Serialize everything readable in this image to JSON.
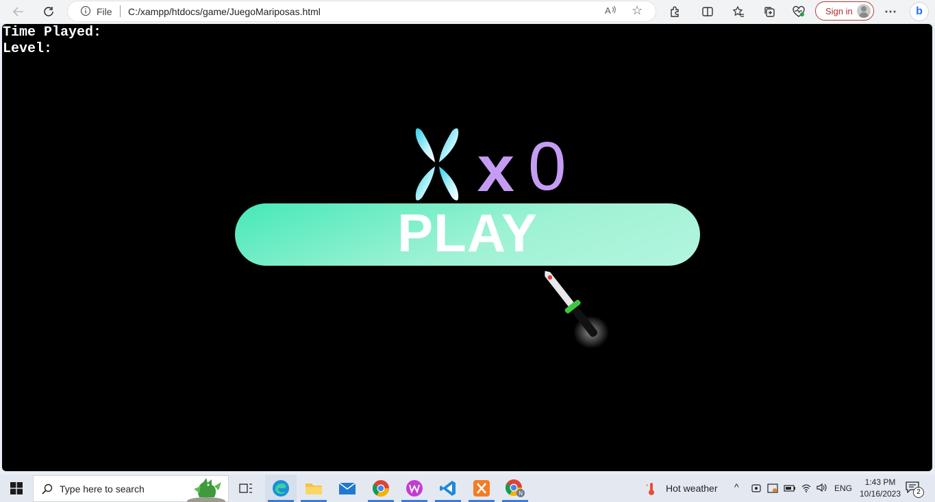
{
  "browser": {
    "address_prefix": "File",
    "url": "C:/xampp/htdocs/game/JuegoMariposas.html",
    "read_aloud": "Aஶ",
    "signin_label": "Sign in",
    "bing_label": "b"
  },
  "game": {
    "hud": {
      "time_label": "Time Played:",
      "level_label": "Level:"
    },
    "counter": {
      "multiplier": "x",
      "count": "0"
    },
    "play_label": "PLAY",
    "colors": {
      "background": "#000000",
      "counter": "#c59cf3",
      "play_start": "#45e8b8",
      "play_end": "#b4f5df"
    }
  },
  "taskbar": {
    "search_placeholder": "Type here to search",
    "weather": "Hot weather",
    "language": "ENG",
    "time": "1:43 PM",
    "date": "10/16/2023",
    "notifications": "2",
    "apps": [
      "task-view",
      "edge",
      "file-explorer",
      "mail",
      "chrome",
      "wps-office",
      "vscode",
      "xampp",
      "chrome-profile"
    ]
  }
}
